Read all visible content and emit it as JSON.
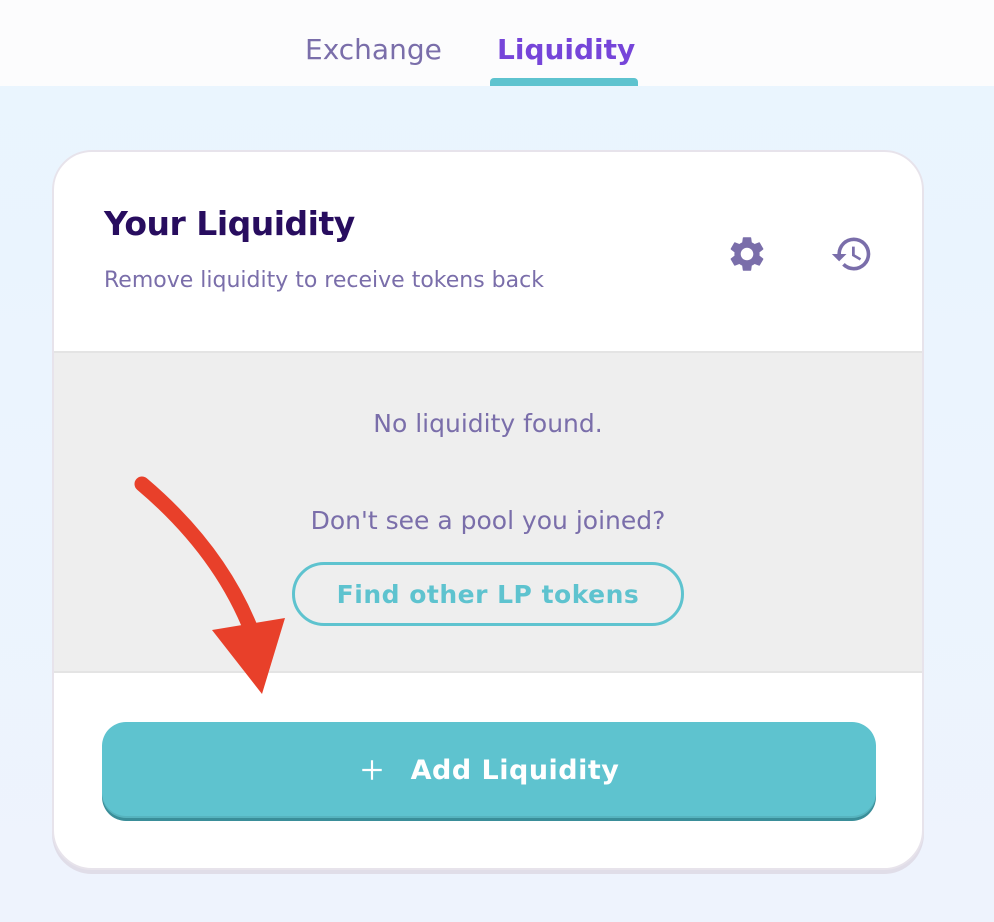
{
  "nav": {
    "tabs": [
      {
        "label": "Exchange",
        "active": false
      },
      {
        "label": "Liquidity",
        "active": true
      }
    ]
  },
  "card": {
    "title": "Your Liquidity",
    "subtitle": "Remove liquidity to receive tokens back",
    "icons": [
      "settings-gear-icon",
      "history-icon"
    ]
  },
  "empty_state": {
    "message": "No liquidity found.",
    "prompt": "Don't see a pool you joined?",
    "find_button_label": "Find other LP tokens"
  },
  "footer": {
    "add_button_label": "Add Liquidity"
  },
  "colors": {
    "primary": "#5ec3cf",
    "accent": "#7645d9",
    "heading": "#280d5f",
    "text_muted": "#7a6eaa",
    "annotation_arrow": "#e8402a"
  }
}
